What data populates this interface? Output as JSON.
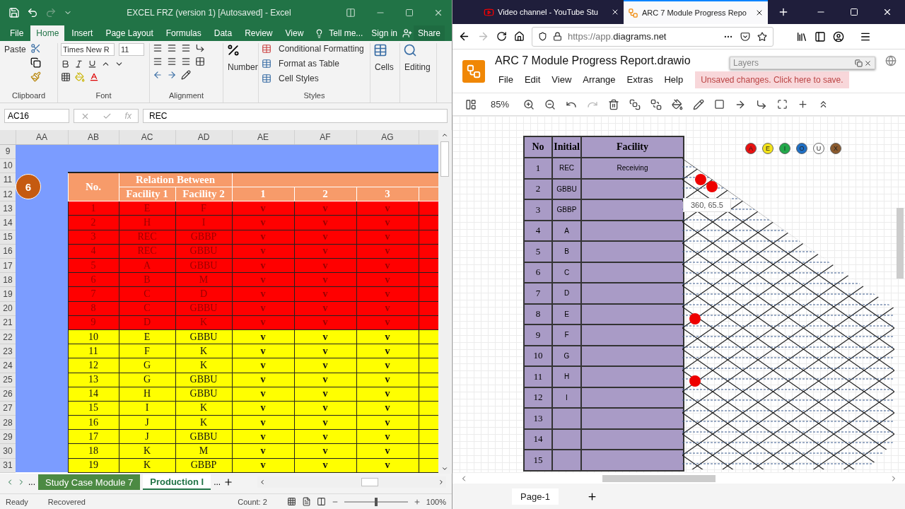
{
  "excel": {
    "title": "EXCEL FRZ (version 1) [Autosaved] - Excel",
    "tabs": [
      {
        "label": "File",
        "selected": false
      },
      {
        "label": "Home",
        "selected": true
      },
      {
        "label": "Insert",
        "selected": false
      },
      {
        "label": "Page Layout",
        "selected": false
      },
      {
        "label": "Formulas",
        "selected": false
      },
      {
        "label": "Data",
        "selected": false
      },
      {
        "label": "Review",
        "selected": false
      },
      {
        "label": "View",
        "selected": false
      }
    ],
    "tell_me": "Tell me...",
    "sign_in": "Sign in",
    "share": "Share",
    "ribbon": {
      "paste": "Paste",
      "font_name": "Times New R",
      "font_size": "11",
      "number": "Number",
      "conditional_formatting": "Conditional Formatting",
      "format_as_table": "Format as Table",
      "cell_styles": "Cell Styles",
      "cells": "Cells",
      "editing": "Editing",
      "groups": [
        "Clipboard",
        "Font",
        "Alignment",
        "Styles"
      ]
    },
    "name_box": "AC16",
    "fx": "fx",
    "formula": "REC",
    "sheet": {
      "columns": [
        "AA",
        "AB",
        "AC",
        "AD",
        "AE",
        "AF",
        "AG"
      ],
      "blank_rows": [
        "9",
        "10"
      ],
      "header_rows": [
        "11",
        "12"
      ],
      "badge": "6",
      "header": {
        "no": "No.",
        "relation": "Relation Between",
        "facility_1": "Facility 1",
        "facility_2": "Facility 2",
        "numbers": [
          "1",
          "2",
          "3"
        ]
      },
      "rows": [
        {
          "row": "13",
          "no": "1",
          "f1": "E",
          "f2": "F",
          "marks": [
            "v",
            "v",
            "v"
          ],
          "color": "#ff0000"
        },
        {
          "row": "14",
          "no": "2",
          "f1": "H",
          "f2": "I",
          "marks": [
            "v",
            "v",
            "v"
          ],
          "color": "#ff0000"
        },
        {
          "row": "15",
          "no": "3",
          "f1": "REC",
          "f2": "GBBP",
          "marks": [
            "v",
            "v",
            "v"
          ],
          "color": "#ff0000"
        },
        {
          "row": "16",
          "no": "4",
          "f1": "REC",
          "f2": "GBBU",
          "marks": [
            "v",
            "v",
            "v"
          ],
          "color": "#ff0000"
        },
        {
          "row": "17",
          "no": "5",
          "f1": "A",
          "f2": "GBBU",
          "marks": [
            "v",
            "v",
            "v"
          ],
          "color": "#ff0000"
        },
        {
          "row": "18",
          "no": "6",
          "f1": "B",
          "f2": "M",
          "marks": [
            "v",
            "v",
            "v"
          ],
          "color": "#ff0000"
        },
        {
          "row": "19",
          "no": "7",
          "f1": "C",
          "f2": "D",
          "marks": [
            "v",
            "v",
            "v"
          ],
          "color": "#ff0000"
        },
        {
          "row": "20",
          "no": "8",
          "f1": "C",
          "f2": "GBBU",
          "marks": [
            "v",
            "v",
            "v"
          ],
          "color": "#ff0000"
        },
        {
          "row": "21",
          "no": "9",
          "f1": "D",
          "f2": "K",
          "marks": [
            "v",
            "v",
            "v"
          ],
          "color": "#ff0000"
        },
        {
          "row": "22",
          "no": "10",
          "f1": "E",
          "f2": "GBBU",
          "marks": [
            "v",
            "v",
            "v"
          ],
          "color": "#ffff00"
        },
        {
          "row": "23",
          "no": "11",
          "f1": "F",
          "f2": "K",
          "marks": [
            "v",
            "v",
            "v"
          ],
          "color": "#ffff00"
        },
        {
          "row": "24",
          "no": "12",
          "f1": "G",
          "f2": "K",
          "marks": [
            "v",
            "v",
            "v"
          ],
          "color": "#ffff00"
        },
        {
          "row": "25",
          "no": "13",
          "f1": "G",
          "f2": "GBBU",
          "marks": [
            "v",
            "v",
            "v"
          ],
          "color": "#ffff00"
        },
        {
          "row": "26",
          "no": "14",
          "f1": "H",
          "f2": "GBBU",
          "marks": [
            "v",
            "v",
            "v"
          ],
          "color": "#ffff00"
        },
        {
          "row": "27",
          "no": "15",
          "f1": "I",
          "f2": "K",
          "marks": [
            "v",
            "v",
            "v"
          ],
          "color": "#ffff00"
        },
        {
          "row": "28",
          "no": "16",
          "f1": "J",
          "f2": "K",
          "marks": [
            "v",
            "v",
            "v"
          ],
          "color": "#ffff00"
        },
        {
          "row": "29",
          "no": "17",
          "f1": "J",
          "f2": "GBBU",
          "marks": [
            "v",
            "v",
            "v"
          ],
          "color": "#ffff00"
        },
        {
          "row": "30",
          "no": "18",
          "f1": "K",
          "f2": "M",
          "marks": [
            "v",
            "v",
            "v"
          ],
          "color": "#ffff00"
        },
        {
          "row": "31",
          "no": "19",
          "f1": "K",
          "f2": "GBBP",
          "marks": [
            "v",
            "v",
            "v"
          ],
          "color": "#ffff00"
        }
      ]
    },
    "sheet_tabs": [
      {
        "label": "Study Case Module 7",
        "selected": false
      },
      {
        "label": "Production I",
        "selected": true
      }
    ],
    "sheet_nav_more": "...",
    "sheet_tabs_more": "...",
    "status": {
      "ready": "Ready",
      "recovered": "Recovered",
      "count": "Count: 2",
      "zoom": "100%",
      "zoom_slider": {
        "level": 0.5
      }
    }
  },
  "browser": {
    "tabs": [
      {
        "title": "Video channel - YouTube Stu",
        "selected": false
      },
      {
        "title": "ARC 7 Module Progress Repo",
        "selected": true
      }
    ],
    "url_prefix": "https://app.",
    "url_domain": "diagrams.net",
    "drawio": {
      "title": "ARC 7 Module Progress Report.drawio",
      "menu": [
        "File",
        "Edit",
        "View",
        "Arrange",
        "Extras",
        "Help"
      ],
      "unsaved": "Unsaved changes. Click here to save.",
      "layers": "Layers",
      "zoom": "85%",
      "table": {
        "columns": [
          "No",
          "Initial",
          "Facility"
        ],
        "rows": [
          {
            "no": "1",
            "initial": "REC",
            "facility": "Receiving"
          },
          {
            "no": "2",
            "initial": "GBBU"
          },
          {
            "no": "3",
            "initial": "GBBP"
          },
          {
            "no": "4",
            "initial": "A"
          },
          {
            "no": "5",
            "initial": "B"
          },
          {
            "no": "6",
            "initial": "C"
          },
          {
            "no": "7",
            "initial": "D"
          },
          {
            "no": "8",
            "initial": "E"
          },
          {
            "no": "9",
            "initial": "F"
          },
          {
            "no": "10",
            "initial": "G"
          },
          {
            "no": "11",
            "initial": "H"
          },
          {
            "no": "12",
            "initial": "I"
          },
          {
            "no": "13"
          },
          {
            "no": "14"
          },
          {
            "no": "15"
          }
        ]
      },
      "legend": [
        {
          "letter": "A",
          "color": "#e81010"
        },
        {
          "letter": "E",
          "color": "#f2e21a"
        },
        {
          "letter": "I",
          "color": "#22a84a"
        },
        {
          "letter": "O",
          "color": "#1f6fc4"
        },
        {
          "letter": "U",
          "color": "#ffffff"
        },
        {
          "letter": "X",
          "color": "#8a5a2e"
        }
      ],
      "tooltip": "360, 65.5",
      "page_tab": "Page-1"
    }
  }
}
